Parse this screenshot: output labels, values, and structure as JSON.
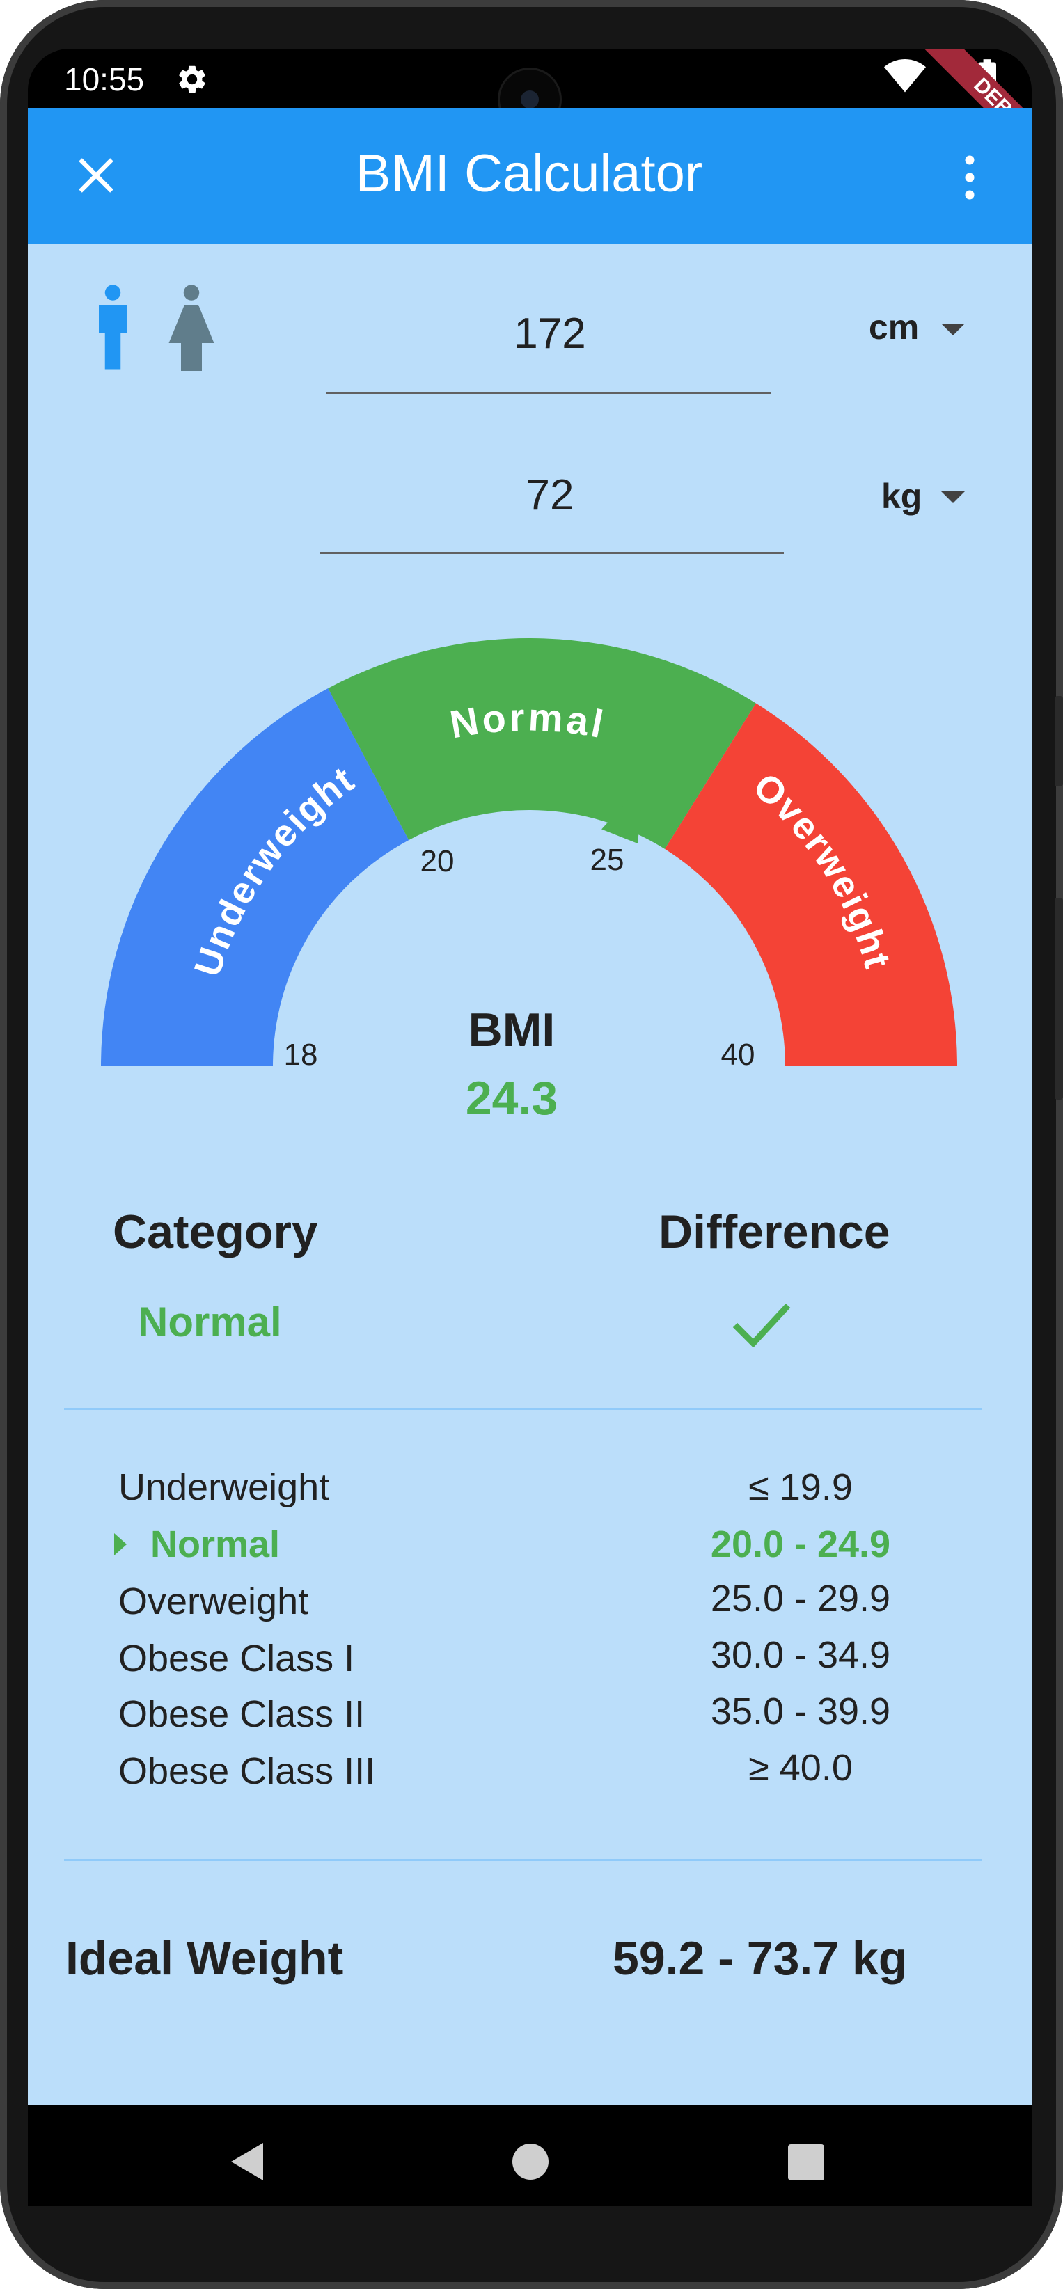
{
  "status_bar": {
    "time": "10:55",
    "debug_banner": "DEBUG"
  },
  "app_bar": {
    "title": "BMI Calculator"
  },
  "inputs": {
    "height": {
      "value": "172",
      "unit": "cm"
    },
    "weight": {
      "value": "72",
      "unit": "kg"
    },
    "gender_selected": "male"
  },
  "gauge": {
    "segments": [
      {
        "label": "Underweight",
        "color": "#4285f4"
      },
      {
        "label": "Normal",
        "color": "#4caf50"
      },
      {
        "label": "Overweight",
        "color": "#f44336"
      }
    ],
    "ticks": [
      "18",
      "20",
      "25",
      "40"
    ],
    "min": 18,
    "max": 40,
    "pointer_value": 24.3
  },
  "result": {
    "bmi_label": "BMI",
    "bmi_value": "24.3"
  },
  "summary": {
    "category_header": "Category",
    "difference_header": "Difference",
    "category_value": "Normal",
    "difference_icon": "check-icon"
  },
  "table": [
    {
      "name": "Underweight",
      "range": "≤ 19.9"
    },
    {
      "name": "Normal",
      "range": "20.0 - 24.9"
    },
    {
      "name": "Overweight",
      "range": "25.0 - 29.9"
    },
    {
      "name": "Obese Class I",
      "range": "30.0 - 34.9"
    },
    {
      "name": "Obese Class II",
      "range": "35.0 - 39.9"
    },
    {
      "name": "Obese Class III",
      "range": "≥ 40.0"
    }
  ],
  "ideal_weight": {
    "label": "Ideal Weight",
    "value": "59.2 - 73.7 kg"
  },
  "colors": {
    "primary": "#2196f3",
    "background": "#bbdefa",
    "normal": "#4caf50",
    "icon_active": "#2196f3",
    "icon_inactive": "#607d8b"
  }
}
